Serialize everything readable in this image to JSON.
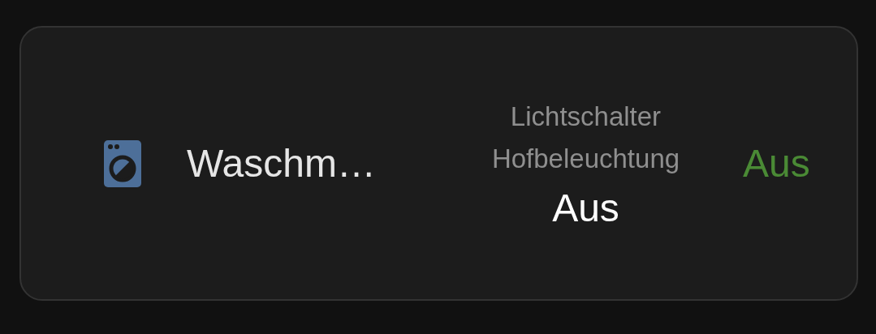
{
  "card": {
    "name": "Waschm…",
    "details": [
      "Lichtschalter",
      "Hofbeleuchtung"
    ],
    "detail_state": "Aus",
    "state": "Aus"
  }
}
